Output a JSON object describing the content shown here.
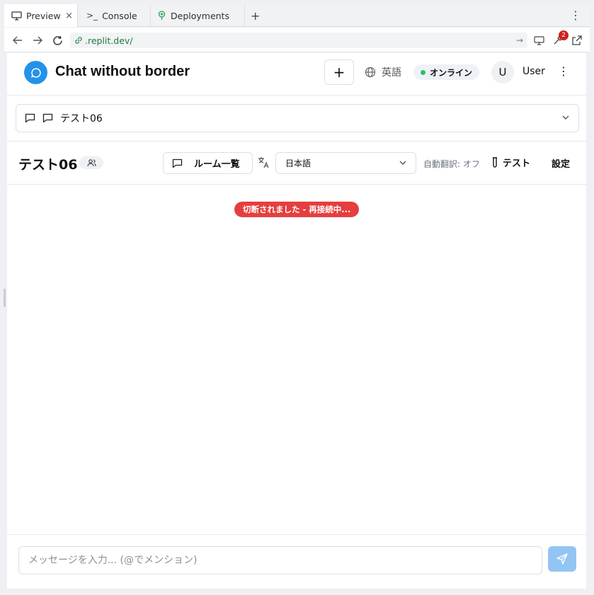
{
  "browser": {
    "tabs": [
      {
        "label": "Preview",
        "active": true,
        "close": "×"
      },
      {
        "label": "Console",
        "prefix": ">_"
      },
      {
        "label": "Deployments"
      }
    ],
    "new_tab": "+",
    "kebab": "⋮",
    "url": ".replit.dev/",
    "devtools_badge": "2"
  },
  "header": {
    "title": "Chat without border",
    "add_label": "+",
    "language": "英語",
    "status": "オンライン",
    "avatar_initial": "U",
    "user_name": "User",
    "menu": "⋮"
  },
  "room_selector": {
    "value": "テスト06"
  },
  "room_bar": {
    "title": "テスト06",
    "room_list_label": "ルーム一覧",
    "language_value": "日本語",
    "auto_translate": "自動翻訳: オフ",
    "test_label": "テスト",
    "settings_label": "設定"
  },
  "chat": {
    "disconnect_banner": "切断されました - 再接続中..."
  },
  "composer": {
    "placeholder": "メッセージを入力... (@でメンション)"
  },
  "colors": {
    "accent": "#2392e9",
    "online": "#22c55e",
    "error": "#e53e3e",
    "send_disabled": "#93c5f4"
  }
}
